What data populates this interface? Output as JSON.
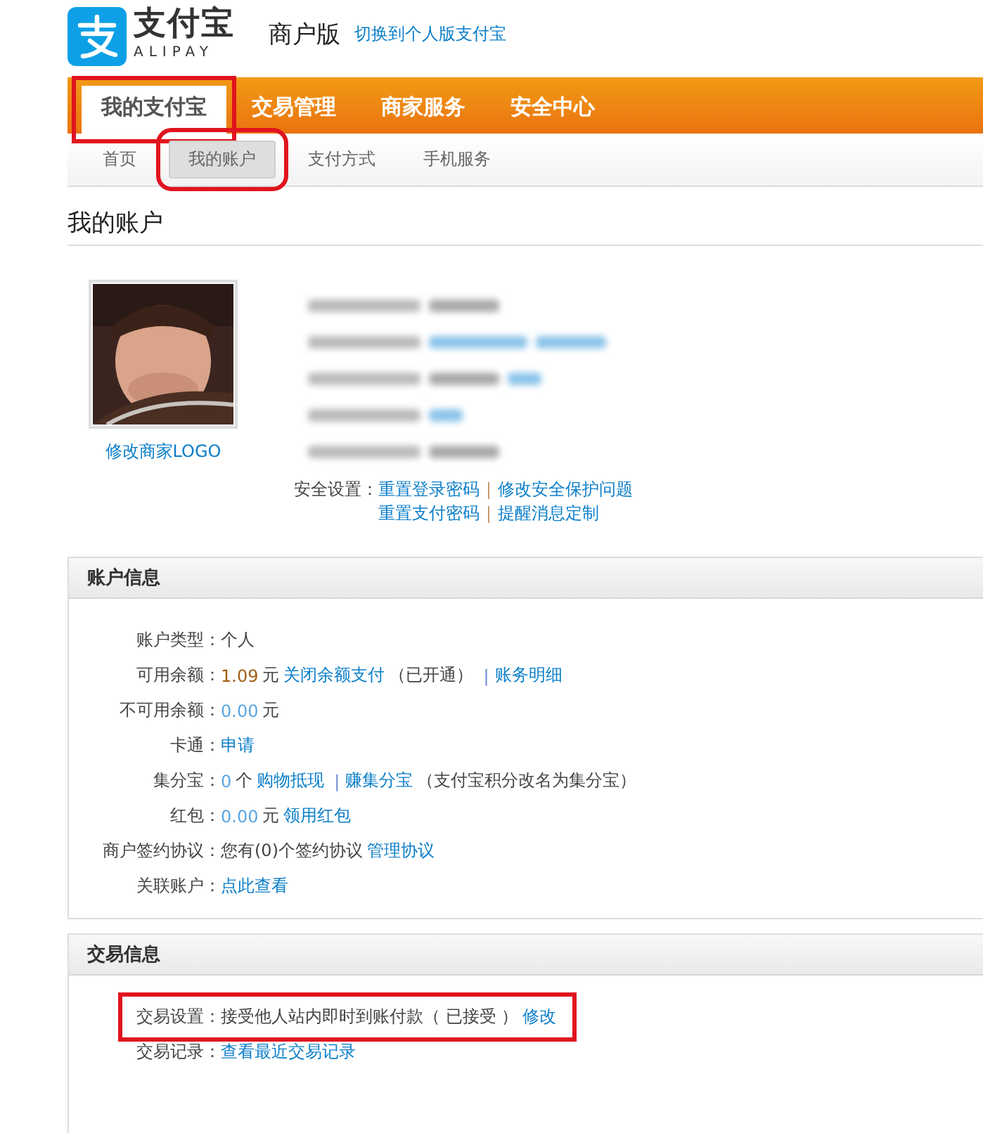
{
  "header": {
    "brand": "支付宝",
    "brand_sub": "ALIPAY",
    "edition": "商户版",
    "switch_link": "切换到个人版支付宝"
  },
  "main_nav": [
    {
      "label": "我的支付宝",
      "selected": true,
      "highlighted": true
    },
    {
      "label": "交易管理",
      "selected": false,
      "highlighted": false
    },
    {
      "label": "商家服务",
      "selected": false,
      "highlighted": false
    },
    {
      "label": "安全中心",
      "selected": false,
      "highlighted": false
    }
  ],
  "sub_nav": [
    {
      "label": "首页",
      "selected": false,
      "highlighted": false
    },
    {
      "label": "我的账户",
      "selected": true,
      "highlighted": true
    },
    {
      "label": "支付方式",
      "selected": false,
      "highlighted": false
    },
    {
      "label": "手机服务",
      "selected": false,
      "highlighted": false
    }
  ],
  "page_title": "我的账户",
  "profile": {
    "logo_link": "修改商家LOGO",
    "redacted_rows": [
      {
        "kind": "plain"
      },
      {
        "kind": "links"
      },
      {
        "kind": "mixed"
      },
      {
        "kind": "link"
      },
      {
        "kind": "plain"
      }
    ],
    "security": {
      "label": "安全设置：",
      "lines": [
        [
          "重置登录密码",
          "修改安全保护问题"
        ],
        [
          "重置支付密码",
          "提醒消息定制"
        ]
      ]
    }
  },
  "panels": [
    {
      "title": "账户信息",
      "rows": [
        {
          "label": "账户类型：",
          "parts": [
            {
              "kind": "text",
              "text": "个人"
            }
          ],
          "highlighted": false
        },
        {
          "label": "可用余额：",
          "parts": [
            {
              "kind": "amount",
              "text": "1.09"
            },
            {
              "kind": "text",
              "text": "元"
            },
            {
              "kind": "link",
              "text": "关闭余额支付"
            },
            {
              "kind": "text",
              "text": "（已开通）"
            },
            {
              "kind": "sep",
              "text": "|"
            },
            {
              "kind": "link",
              "text": "账务明细"
            }
          ],
          "highlighted": false
        },
        {
          "label": "不可用余额：",
          "parts": [
            {
              "kind": "number",
              "text": "0.00"
            },
            {
              "kind": "text",
              "text": "元"
            }
          ],
          "highlighted": false
        },
        {
          "label": "卡通：",
          "parts": [
            {
              "kind": "link",
              "text": "申请"
            }
          ],
          "highlighted": false
        },
        {
          "label": "集分宝：",
          "parts": [
            {
              "kind": "number",
              "text": "0"
            },
            {
              "kind": "text",
              "text": "个"
            },
            {
              "kind": "link",
              "text": "购物抵现"
            },
            {
              "kind": "sep",
              "text": "|"
            },
            {
              "kind": "link",
              "text": "赚集分宝"
            },
            {
              "kind": "text",
              "text": "（支付宝积分改名为集分宝）"
            }
          ],
          "highlighted": false
        },
        {
          "label": "红包：",
          "parts": [
            {
              "kind": "number",
              "text": "0.00"
            },
            {
              "kind": "text",
              "text": "元"
            },
            {
              "kind": "link",
              "text": "领用红包"
            }
          ],
          "highlighted": false
        },
        {
          "label": "商户签约协议：",
          "parts": [
            {
              "kind": "text",
              "text": "您有(0)个签约协议"
            },
            {
              "kind": "link",
              "text": "管理协议"
            }
          ],
          "highlighted": false
        },
        {
          "label": "关联账户：",
          "parts": [
            {
              "kind": "link",
              "text": "点此查看"
            }
          ],
          "highlighted": false
        }
      ]
    },
    {
      "title": "交易信息",
      "rows": [
        {
          "label": "交易设置：",
          "parts": [
            {
              "kind": "text",
              "text": "接受他人站内即时到账付款（ 已接受 ）"
            },
            {
              "kind": "link",
              "text": "修改"
            }
          ],
          "highlighted": true
        },
        {
          "label": "交易记录：",
          "parts": [
            {
              "kind": "link",
              "text": "查看最近交易记录"
            }
          ],
          "highlighted": false
        }
      ]
    }
  ]
}
